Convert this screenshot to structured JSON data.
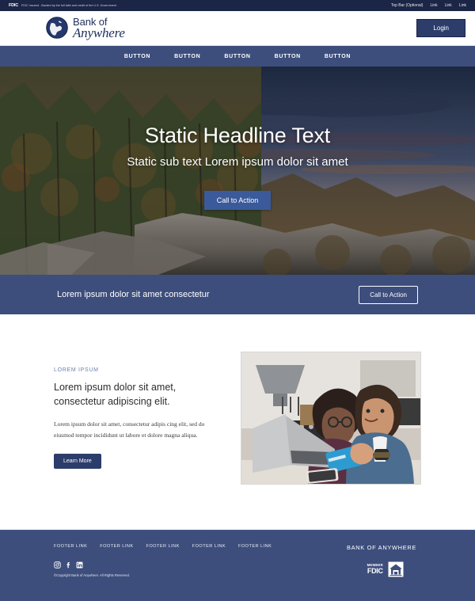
{
  "topbar": {
    "fdic_mark": "FDIC",
    "fdic_note": "FDIC Insured - Backed by the full faith and credit of the U.S. Government",
    "optional_label": "Top Bar (Optional)",
    "links": [
      "Link",
      "Link",
      "Link"
    ]
  },
  "header": {
    "brand_line1": "Bank of",
    "brand_line2": "Anywhere",
    "login_label": "Login",
    "logo_icon": "globe-icon"
  },
  "nav": {
    "items": [
      "BUTTON",
      "BUTTON",
      "BUTTON",
      "BUTTON",
      "BUTTON"
    ]
  },
  "hero": {
    "title": "Static Headline Text",
    "subtitle": "Static sub text Lorem ipsum dolor sit amet",
    "cta_label": "Call to Action",
    "image_alt": "autumn forest cliffs at sunset"
  },
  "cta_band": {
    "text": "Lorem ipsum dolor sit amet consectetur",
    "button_label": "Call to Action"
  },
  "content": {
    "eyebrow": "LOREM IPSUM",
    "heading": "Lorem ipsum dolor sit amet, consectetur adipiscing elit.",
    "body": "Lorem ipsum dolor sit amet, consectetur adipis cing elit, sed do eiusmod tempor incididunt ut labore et dolore magna aliqua.",
    "button_label": "Learn More",
    "image_alt": "couple using laptop and credit card in kitchen"
  },
  "footer": {
    "links": [
      "FOOTER LINK",
      "FOOTER LINK",
      "FOOTER LINK",
      "FOOTER LINK",
      "FOOTER LINK"
    ],
    "brand": "BANK OF ANYWHERE",
    "copyright": "©Copyright Bank of Anywhere. All Rights Reserved.",
    "socials": [
      "instagram-icon",
      "facebook-icon",
      "linkedin-icon"
    ],
    "fdic_member_top": "MEMBER",
    "fdic_member_bottom": "FDIC",
    "housing_badge": "equal-housing-lender-icon"
  },
  "colors": {
    "topbar_navy": "#1b2545",
    "brand_navy": "#2c3c6b",
    "band_blue": "#3d4e7d",
    "hero_cta": "#3a5a9b",
    "eyebrow": "#6d7fa8"
  }
}
